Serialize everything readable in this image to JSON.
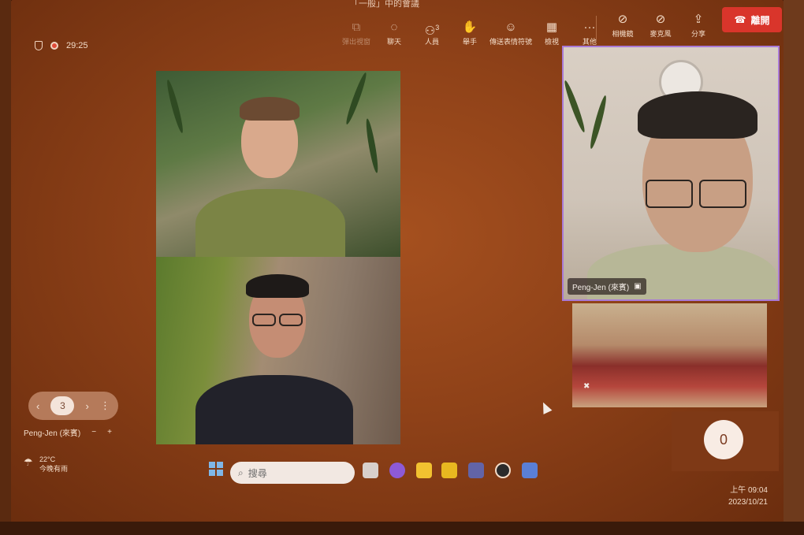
{
  "meeting": {
    "title": "「一般」中的會議",
    "timer": "29:25"
  },
  "toolbar": {
    "items": [
      {
        "label": "彈出視窗",
        "icon": "popout-icon",
        "glyph": "⧉",
        "enabled": false
      },
      {
        "label": "聊天",
        "icon": "chat-icon",
        "glyph": "💬",
        "enabled": true
      },
      {
        "label": "人員",
        "icon": "people-icon",
        "glyph": "👥",
        "badge": "3",
        "enabled": true
      },
      {
        "label": "舉手",
        "icon": "raise-hand-icon",
        "glyph": "✋",
        "enabled": true
      },
      {
        "label": "傳送表情符號",
        "icon": "emoji-icon",
        "glyph": "☺",
        "enabled": true
      },
      {
        "label": "檢視",
        "icon": "view-icon",
        "glyph": "▦",
        "enabled": true
      },
      {
        "label": "其他",
        "icon": "more-icon",
        "glyph": "···",
        "enabled": true
      }
    ],
    "device_items": [
      {
        "label": "相機鏡",
        "icon": "camera-off-icon",
        "glyph": "📷"
      },
      {
        "label": "麥克風",
        "icon": "mic-off-icon",
        "glyph": "🎙"
      },
      {
        "label": "分享",
        "icon": "share-icon",
        "glyph": "⤴"
      }
    ],
    "leave_label": "離開"
  },
  "participants": {
    "featured_name": "Peng-Jen (來賓)",
    "extra_count": "0"
  },
  "pager": {
    "current": "3",
    "name": "Peng-Jen (來賓)",
    "minus": "−",
    "plus": "+"
  },
  "taskbar": {
    "weather_temp": "22°C",
    "weather_desc": "今晚有雨",
    "search_placeholder": "搜尋",
    "time": "上午 09:04",
    "date": "2023/10/21"
  }
}
